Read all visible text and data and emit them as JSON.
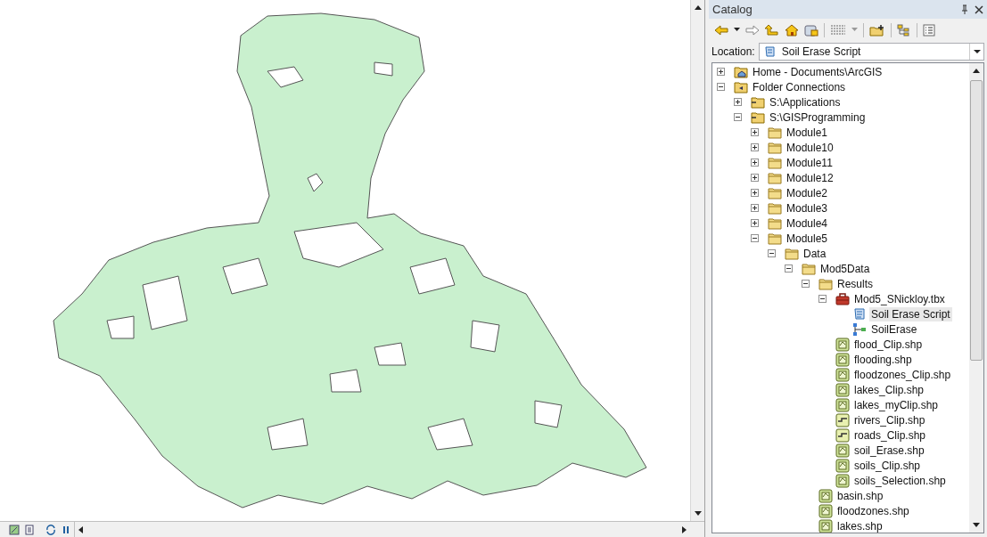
{
  "catalog": {
    "title": "Catalog",
    "location": {
      "label": "Location:",
      "value": "Soil Erase Script"
    },
    "tree": [
      {
        "label": "Home - Documents\\ArcGIS",
        "kind": "home-folder",
        "expanded": false,
        "selected": false
      },
      {
        "label": "Folder Connections",
        "kind": "folder-connection",
        "expanded": true,
        "selected": false,
        "children": [
          {
            "label": "S:\\Applications",
            "kind": "connection",
            "expanded": false,
            "selected": false
          },
          {
            "label": "S:\\GISProgramming",
            "kind": "connection",
            "expanded": true,
            "selected": false,
            "children": [
              {
                "label": "Module1",
                "kind": "folder",
                "expanded": false,
                "selected": false
              },
              {
                "label": "Module10",
                "kind": "folder",
                "expanded": false,
                "selected": false
              },
              {
                "label": "Module11",
                "kind": "folder",
                "expanded": false,
                "selected": false
              },
              {
                "label": "Module12",
                "kind": "folder",
                "expanded": false,
                "selected": false
              },
              {
                "label": "Module2",
                "kind": "folder",
                "expanded": false,
                "selected": false
              },
              {
                "label": "Module3",
                "kind": "folder",
                "expanded": false,
                "selected": false
              },
              {
                "label": "Module4",
                "kind": "folder",
                "expanded": false,
                "selected": false
              },
              {
                "label": "Module5",
                "kind": "folder",
                "expanded": true,
                "selected": false,
                "children": [
                  {
                    "label": "Data",
                    "kind": "folder",
                    "expanded": true,
                    "selected": false,
                    "children": [
                      {
                        "label": "Mod5Data",
                        "kind": "folder",
                        "expanded": true,
                        "selected": false,
                        "children": [
                          {
                            "label": "Results",
                            "kind": "folder",
                            "expanded": true,
                            "selected": false,
                            "children": [
                              {
                                "label": "Mod5_SNickloy.tbx",
                                "kind": "toolbox",
                                "expanded": true,
                                "selected": false,
                                "children": [
                                  {
                                    "label": "Soil Erase Script",
                                    "kind": "script",
                                    "selected": true
                                  },
                                  {
                                    "label": "SoilErase",
                                    "kind": "model",
                                    "selected": false
                                  }
                                ]
                              },
                              {
                                "label": "flood_Clip.shp",
                                "kind": "polygon",
                                "selected": false
                              },
                              {
                                "label": "flooding.shp",
                                "kind": "polygon",
                                "selected": false
                              },
                              {
                                "label": "floodzones_Clip.shp",
                                "kind": "polygon",
                                "selected": false
                              },
                              {
                                "label": "lakes_Clip.shp",
                                "kind": "polygon",
                                "selected": false
                              },
                              {
                                "label": "lakes_myClip.shp",
                                "kind": "polygon",
                                "selected": false
                              },
                              {
                                "label": "rivers_Clip.shp",
                                "kind": "line",
                                "selected": false
                              },
                              {
                                "label": "roads_Clip.shp",
                                "kind": "line",
                                "selected": false
                              },
                              {
                                "label": "soil_Erase.shp",
                                "kind": "polygon",
                                "selected": false
                              },
                              {
                                "label": "soils_Clip.shp",
                                "kind": "polygon",
                                "selected": false
                              },
                              {
                                "label": "soils_Selection.shp",
                                "kind": "polygon",
                                "selected": false
                              }
                            ]
                          },
                          {
                            "label": "basin.shp",
                            "kind": "polygon",
                            "selected": false
                          },
                          {
                            "label": "floodzones.shp",
                            "kind": "polygon",
                            "selected": false
                          },
                          {
                            "label": "lakes.shp",
                            "kind": "polygon",
                            "selected": false
                          }
                        ]
                      }
                    ]
                  }
                ]
              }
            ]
          }
        ]
      }
    ]
  }
}
